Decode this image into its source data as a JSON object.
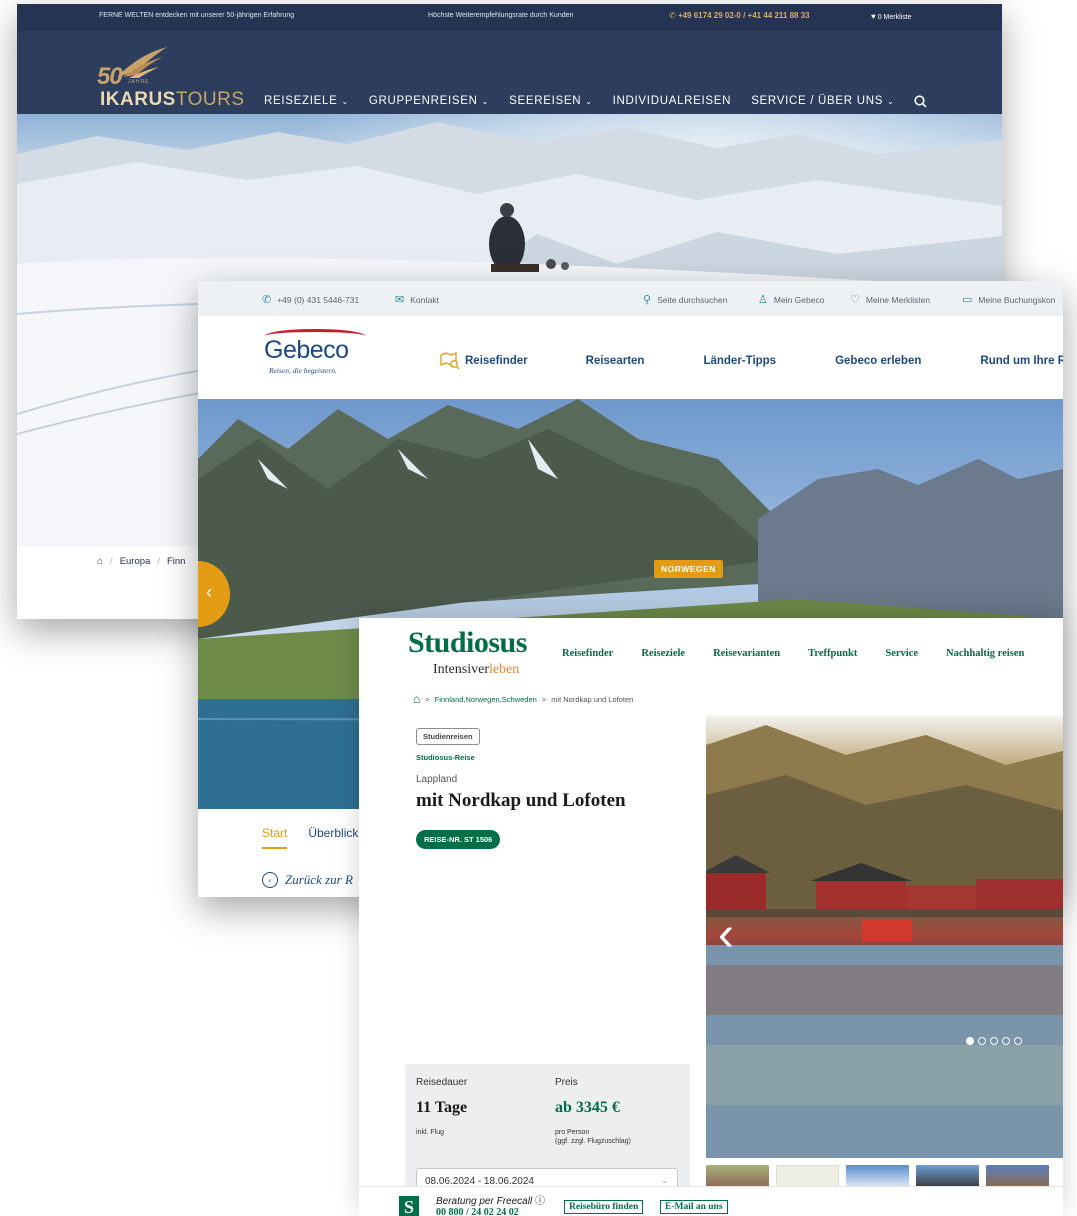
{
  "ikarus": {
    "topbar": {
      "left_text": "FERNE WELTEN entdecken mit unserer 50-jährigen Erfahrung",
      "center_text": "Höchste Weiterempfehlungsrate durch Kunden",
      "phone": "+49 6174 29 02-0 / +41 44 211 88 33",
      "wishlist": "0 Merkliste"
    },
    "logo": {
      "number": "50",
      "jahre": "JAHRE",
      "brand_bold": "IKARUS",
      "brand_rest": "TOURS"
    },
    "nav": [
      {
        "label": "REISEZIELE",
        "has_dropdown": true
      },
      {
        "label": "GRUPPENREISEN",
        "has_dropdown": true
      },
      {
        "label": "SEEREISEN",
        "has_dropdown": true
      },
      {
        "label": "INDIVIDUALREISEN",
        "has_dropdown": false
      },
      {
        "label": "SERVICE / ÜBER UNS",
        "has_dropdown": true
      }
    ],
    "breadcrumb": [
      "Europa",
      "Finn"
    ]
  },
  "gebeco": {
    "topbar": {
      "phone": "+49 (0) 431 5446-731",
      "contact": "Kontakt",
      "search": "Seite durchsuchen",
      "account": "Mein Gebeco",
      "wishlists": "Meine Merklisten",
      "bookings": "Meine Buchungskon"
    },
    "logo": {
      "name": "Gebeco",
      "slogan": "Reisen, die begeistern."
    },
    "nav": [
      "Reisefinder",
      "Reisearten",
      "Länder-Tipps",
      "Gebeco erleben",
      "Rund um Ihre R"
    ],
    "hero": {
      "country_tag": "NORWEGEN"
    },
    "tabs": [
      "Start",
      "Überblick"
    ],
    "back_link": "Zurück zur R"
  },
  "studiosus": {
    "logo": {
      "name": "Studiosus",
      "slogan_a": "Intensiver",
      "slogan_b": "leben"
    },
    "nav": [
      "Reisefinder",
      "Reiseziele",
      "Reisevarianten",
      "Treffpunkt",
      "Service",
      "Nachhaltig reisen"
    ],
    "breadcrumb": {
      "region": "Finnland,Norwegen,Schweden",
      "current": "mit Nordkap und Lofoten"
    },
    "chip": "Studienreisen",
    "type": "Studiosus-Reise",
    "region": "Lappland",
    "title": "mit Nordkap und Lofoten",
    "trip_number": "REISE-NR. ST 1506",
    "facts": {
      "duration_label": "Reisedauer",
      "duration_value": "11 Tage",
      "duration_note": "inkl. Flug",
      "price_label": "Preis",
      "price_value": "ab 3345 €",
      "price_note_1": "pro Person",
      "price_note_2": "(ggf. zzgl. Flugzuschlag)",
      "date_selected": "08.06.2024 - 18.06.2024"
    },
    "gallery": {
      "slide_count": 5,
      "active_slide": 1
    },
    "bottom": {
      "advice": "Beratung per Freecall",
      "phone": "00 800 / 24 02 24 02",
      "btn_agency": "Reisebüro finden",
      "btn_email": "E-Mail an uns"
    }
  },
  "colors": {
    "ikarus_navy": "#2c3d5e",
    "ikarus_gold": "#c9a46a",
    "gebeco_blue": "#1b4a82",
    "gebeco_orange": "#e39c13",
    "studiosus_green": "#006e47"
  }
}
